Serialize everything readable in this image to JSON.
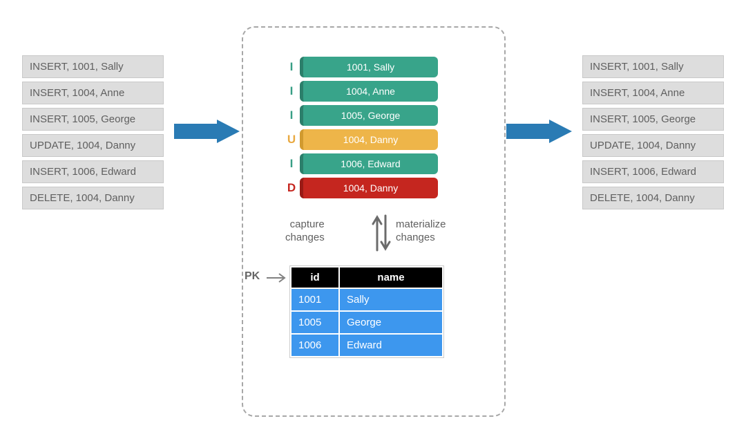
{
  "left_events": [
    "INSERT, 1001, Sally",
    "INSERT, 1004, Anne",
    "INSERT, 1005, George",
    "UPDATE, 1004, Danny",
    "INSERT, 1006, Edward",
    "DELETE, 1004, Danny"
  ],
  "right_events": [
    "INSERT, 1001, Sally",
    "INSERT, 1004, Anne",
    "INSERT, 1005, George",
    "UPDATE, 1004, Danny",
    "INSERT, 1006, Edward",
    "DELETE, 1004, Danny"
  ],
  "changes": [
    {
      "op": "I",
      "text": "1001, Sally",
      "color": "green"
    },
    {
      "op": "I",
      "text": "1004, Anne",
      "color": "green"
    },
    {
      "op": "I",
      "text": "1005, George",
      "color": "green"
    },
    {
      "op": "U",
      "text": "1004, Danny",
      "color": "yellow"
    },
    {
      "op": "I",
      "text": "1006, Edward",
      "color": "green"
    },
    {
      "op": "D",
      "text": "1004, Danny",
      "color": "red"
    }
  ],
  "labels": {
    "capture": "capture\nchanges",
    "materialize": "materialize\nchanges",
    "pk": "PK"
  },
  "table": {
    "headers": {
      "id": "id",
      "name": "name"
    },
    "rows": [
      {
        "id": "1001",
        "name": "Sally"
      },
      {
        "id": "1005",
        "name": "George"
      },
      {
        "id": "1006",
        "name": "Edward"
      }
    ]
  },
  "colors": {
    "arrow": "#2a7bb4",
    "grey_arrow": "#6b6b6b"
  }
}
